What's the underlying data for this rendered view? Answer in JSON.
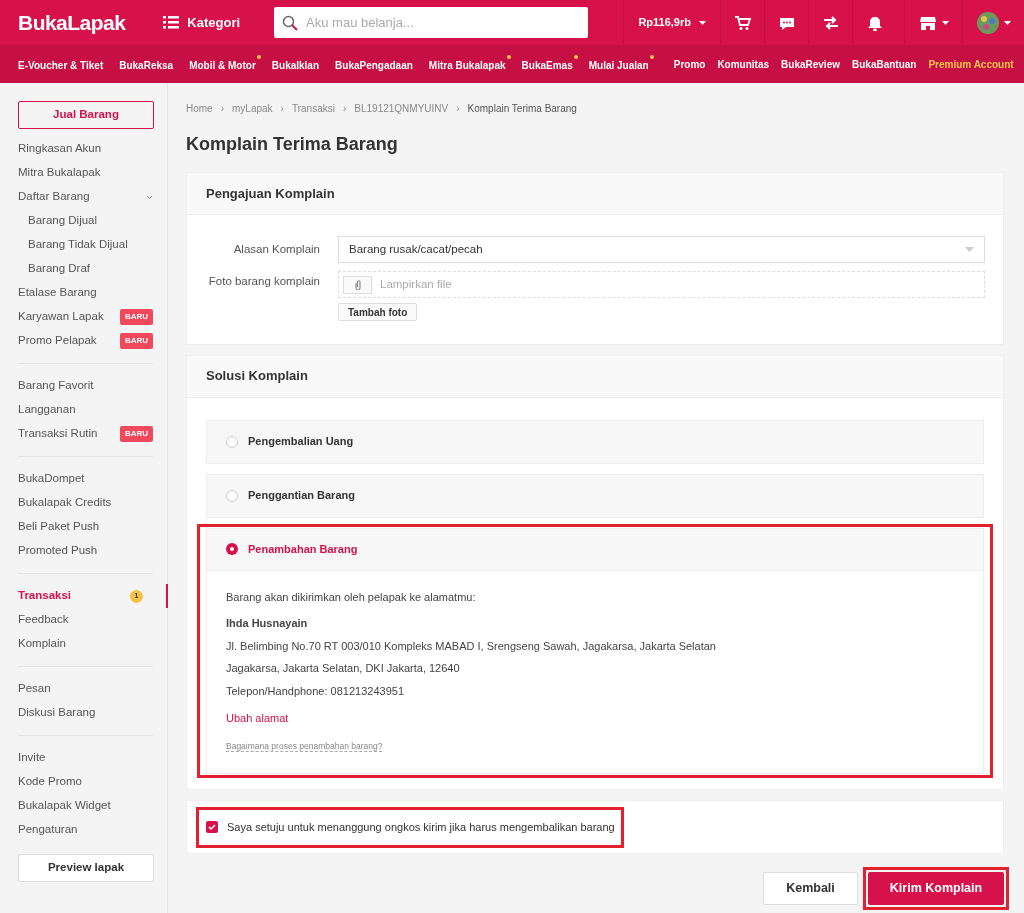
{
  "header": {
    "logo": "BukaLapak",
    "category_button": "Kategori",
    "search": {
      "placeholder": "Aku mau belanja..."
    },
    "balance": "Rp116,9rb"
  },
  "nav": {
    "left": [
      {
        "label": "E-Voucher & Tiket",
        "dot": false
      },
      {
        "label": "BukaReksa",
        "dot": false
      },
      {
        "label": "Mobil & Motor",
        "dot": true
      },
      {
        "label": "BukaIklan",
        "dot": false
      },
      {
        "label": "BukaPengadaan",
        "dot": false
      },
      {
        "label": "Mitra Bukalapak",
        "dot": true
      },
      {
        "label": "BukaEmas",
        "dot": true
      },
      {
        "label": "Mulai Jualan",
        "dot": true
      }
    ],
    "right": [
      {
        "label": "Promo",
        "kind": "link"
      },
      {
        "label": "Komunitas",
        "kind": "link"
      },
      {
        "label": "BukaReview",
        "kind": "link"
      },
      {
        "label": "BukaBantuan",
        "kind": "link"
      },
      {
        "label": "Premium Account",
        "kind": "premium"
      }
    ]
  },
  "sidebar": {
    "sell_button": "Jual Barang",
    "groups": [
      [
        {
          "label": "Ringkasan Akun",
          "selected": false
        },
        {
          "label": "Mitra Bukalapak",
          "selected": false
        },
        {
          "label": "Daftar Barang",
          "selected": false,
          "expanded": true,
          "children": [
            {
              "label": "Barang Dijual",
              "selected": false
            },
            {
              "label": "Barang Tidak Dijual",
              "selected": false
            },
            {
              "label": "Barang Draf",
              "selected": false
            }
          ]
        },
        {
          "label": "Etalase Barang",
          "selected": false
        },
        {
          "label": "Karyawan Lapak",
          "selected": false,
          "badge": "BARU"
        },
        {
          "label": "Promo Pelapak",
          "selected": false,
          "badge": "BARU"
        }
      ],
      [
        {
          "label": "Barang Favorit",
          "selected": false
        },
        {
          "label": "Langganan",
          "selected": false
        },
        {
          "label": "Transaksi Rutin",
          "selected": false,
          "badge": "BARU"
        }
      ],
      [
        {
          "label": "BukaDompet",
          "selected": false
        },
        {
          "label": "Bukalapak Credits",
          "selected": false
        },
        {
          "label": "Beli Paket Push",
          "selected": false
        },
        {
          "label": "Promoted Push",
          "selected": false
        }
      ],
      [
        {
          "label": "Transaksi",
          "selected": true,
          "count": "1"
        },
        {
          "label": "Feedback",
          "selected": false
        },
        {
          "label": "Komplain",
          "selected": false
        }
      ],
      [
        {
          "label": "Pesan",
          "selected": false
        },
        {
          "label": "Diskusi Barang",
          "selected": false
        }
      ],
      [
        {
          "label": "Invite",
          "selected": false
        },
        {
          "label": "Kode Promo",
          "selected": false
        },
        {
          "label": "Bukalapak Widget",
          "selected": false
        },
        {
          "label": "Pengaturan",
          "selected": false
        }
      ]
    ],
    "preview_button": "Preview lapak"
  },
  "breadcrumb": [
    {
      "label": "Home",
      "current": false
    },
    {
      "separator": "›",
      "label": "myLapak",
      "current": false
    },
    {
      "separator": "›",
      "label": "Transaksi",
      "current": false
    },
    {
      "separator": "›",
      "label": "BL19121QNMYUINV",
      "current": false
    },
    {
      "separator": "›",
      "label": "Komplain Terima Barang",
      "current": true
    }
  ],
  "page_title": "Komplain Terima Barang",
  "complaint": {
    "title": "Pengajuan Komplain",
    "reason_label": "Alasan Komplain",
    "reason_value": "Barang rusak/cacat/pecah",
    "photo_label": "Foto barang komplain",
    "photo_placeholder": "Lampirkan file",
    "add_photo_button": "Tambah foto"
  },
  "solution": {
    "title": "Solusi Komplain",
    "options": [
      {
        "label": "Pengembalian Uang",
        "selected": false,
        "highlighted": false
      },
      {
        "label": "Penggantian Barang",
        "selected": false,
        "highlighted": false
      },
      {
        "label": "Penambahan Barang",
        "selected": true,
        "highlighted": true,
        "intro": "Barang akan dikirimkan oleh pelapak ke alamatmu:",
        "name": "Ihda Husnayain",
        "address_lines": [
          "Jl. Belimbing No.70 RT 003/010 Kompleks MABAD I, Srengseng Sawah, Jagakarsa, Jakarta Selatan",
          "Jagakarsa, Jakarta Selatan, DKI Jakarta, 12640",
          "Telepon/Handphone: 081213243951"
        ],
        "change_link": "Ubah alamat",
        "help_link": "Bagaimana proses penambahan barang?"
      }
    ]
  },
  "agreement": {
    "label": "Saya setuju untuk menanggung ongkos kirim jika harus mengembalikan barang",
    "checked": true,
    "highlighted": true
  },
  "actions": [
    {
      "label": "Kembali",
      "kind": "secondary",
      "highlighted": false
    },
    {
      "label": "Kirim Komplain",
      "kind": "primary",
      "highlighted": true
    }
  ]
}
